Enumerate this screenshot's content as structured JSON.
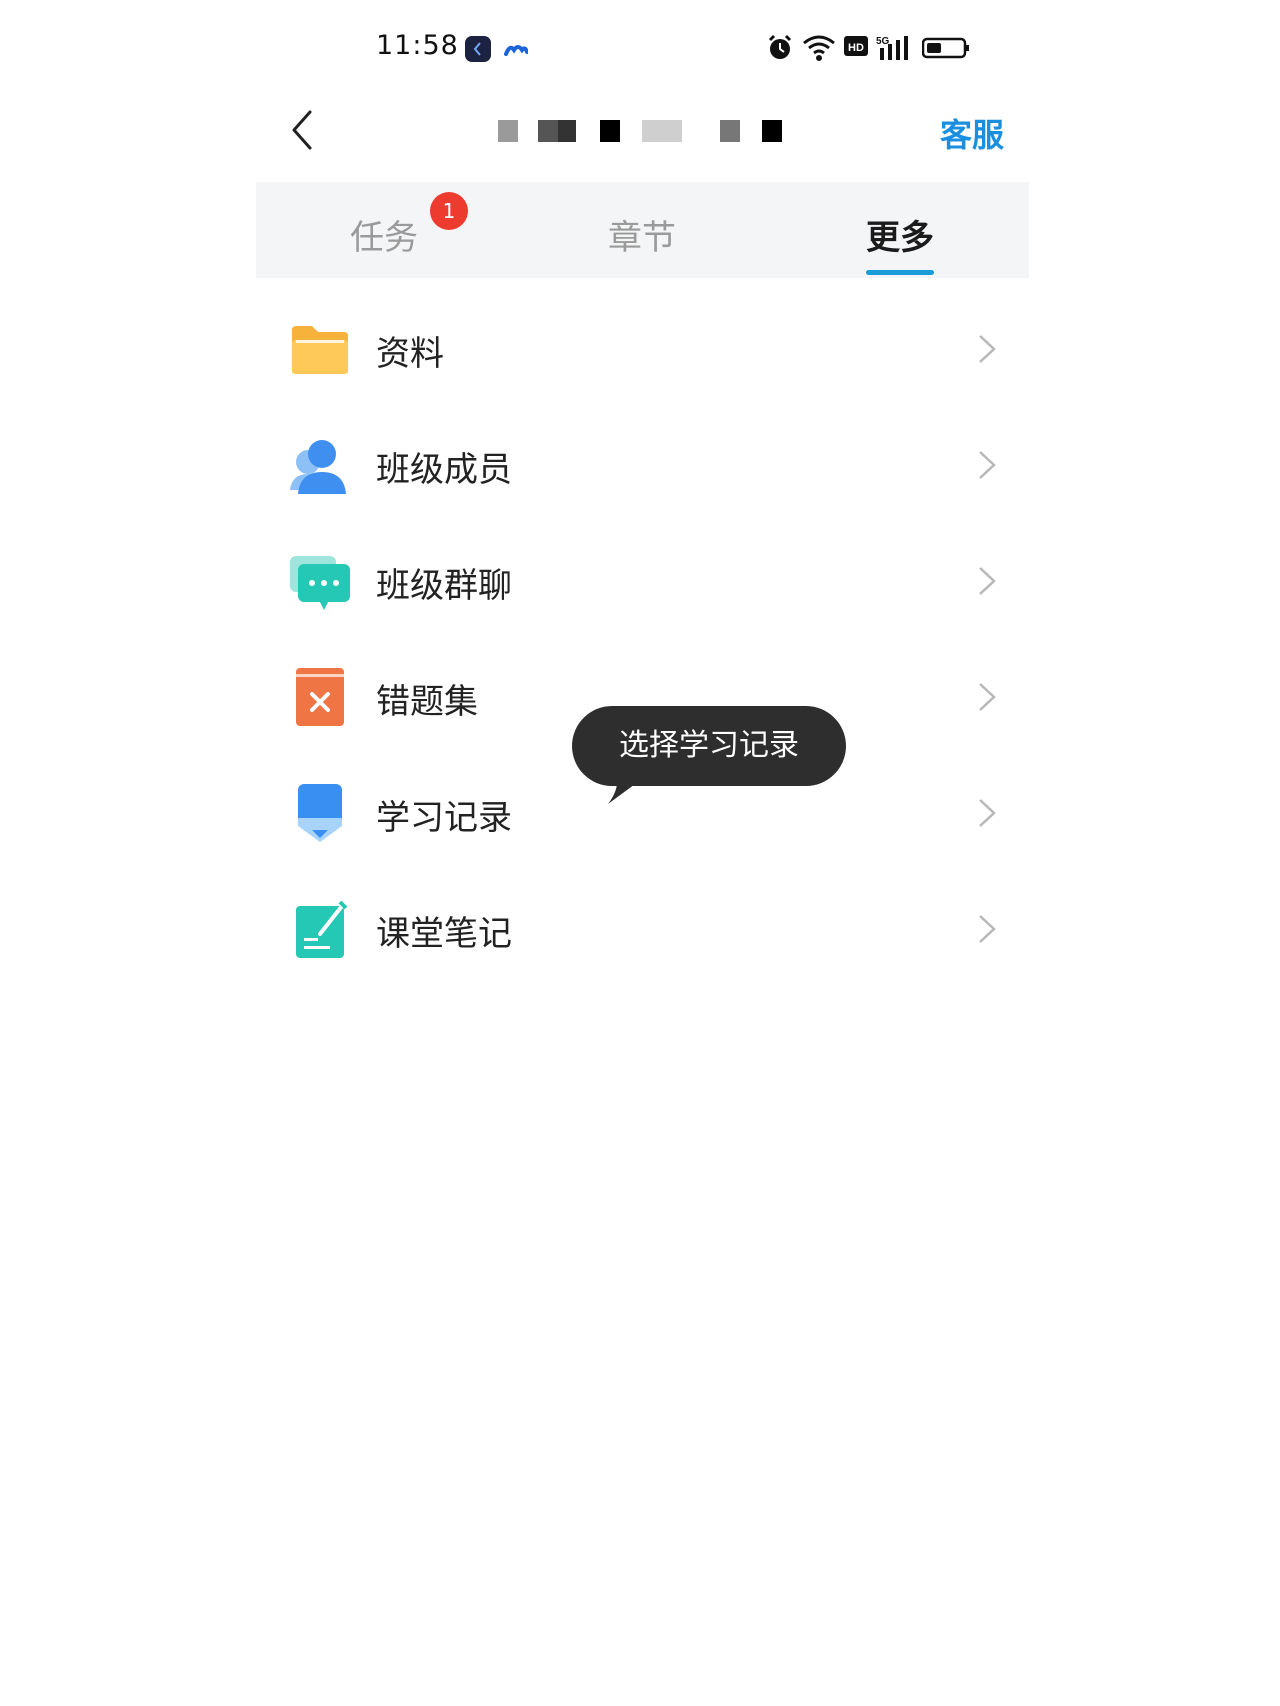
{
  "status_bar": {
    "time": "11:58",
    "icons": [
      "app-icon",
      "cloud-app-icon",
      "alarm-icon",
      "wifi-icon",
      "hd-icon",
      "signal-5g-icon",
      "battery-icon"
    ]
  },
  "header": {
    "back_icon": "chevron-left-icon",
    "service_label": "客服"
  },
  "tabs": [
    {
      "label": "任务",
      "badge": "1",
      "active": false
    },
    {
      "label": "章节",
      "active": false
    },
    {
      "label": "更多",
      "active": true
    }
  ],
  "menu": [
    {
      "label": "资料",
      "icon": "folder-icon",
      "color": "#f7b23b"
    },
    {
      "label": "班级成员",
      "icon": "member-icon",
      "color": "#3f8ff0"
    },
    {
      "label": "班级群聊",
      "icon": "chat-icon",
      "color": "#25c8b4"
    },
    {
      "label": "错题集",
      "icon": "wrong-book-icon",
      "color": "#f07545"
    },
    {
      "label": "学习记录",
      "icon": "study-record-icon",
      "color": "#3a8ff3"
    },
    {
      "label": "课堂笔记",
      "icon": "note-icon",
      "color": "#25c8b4"
    }
  ],
  "tooltip": {
    "text": "选择学习记录"
  },
  "colors": {
    "accent": "#1a8fe0",
    "badge": "#ee3b2f",
    "tab_bg": "#f4f5f7"
  }
}
